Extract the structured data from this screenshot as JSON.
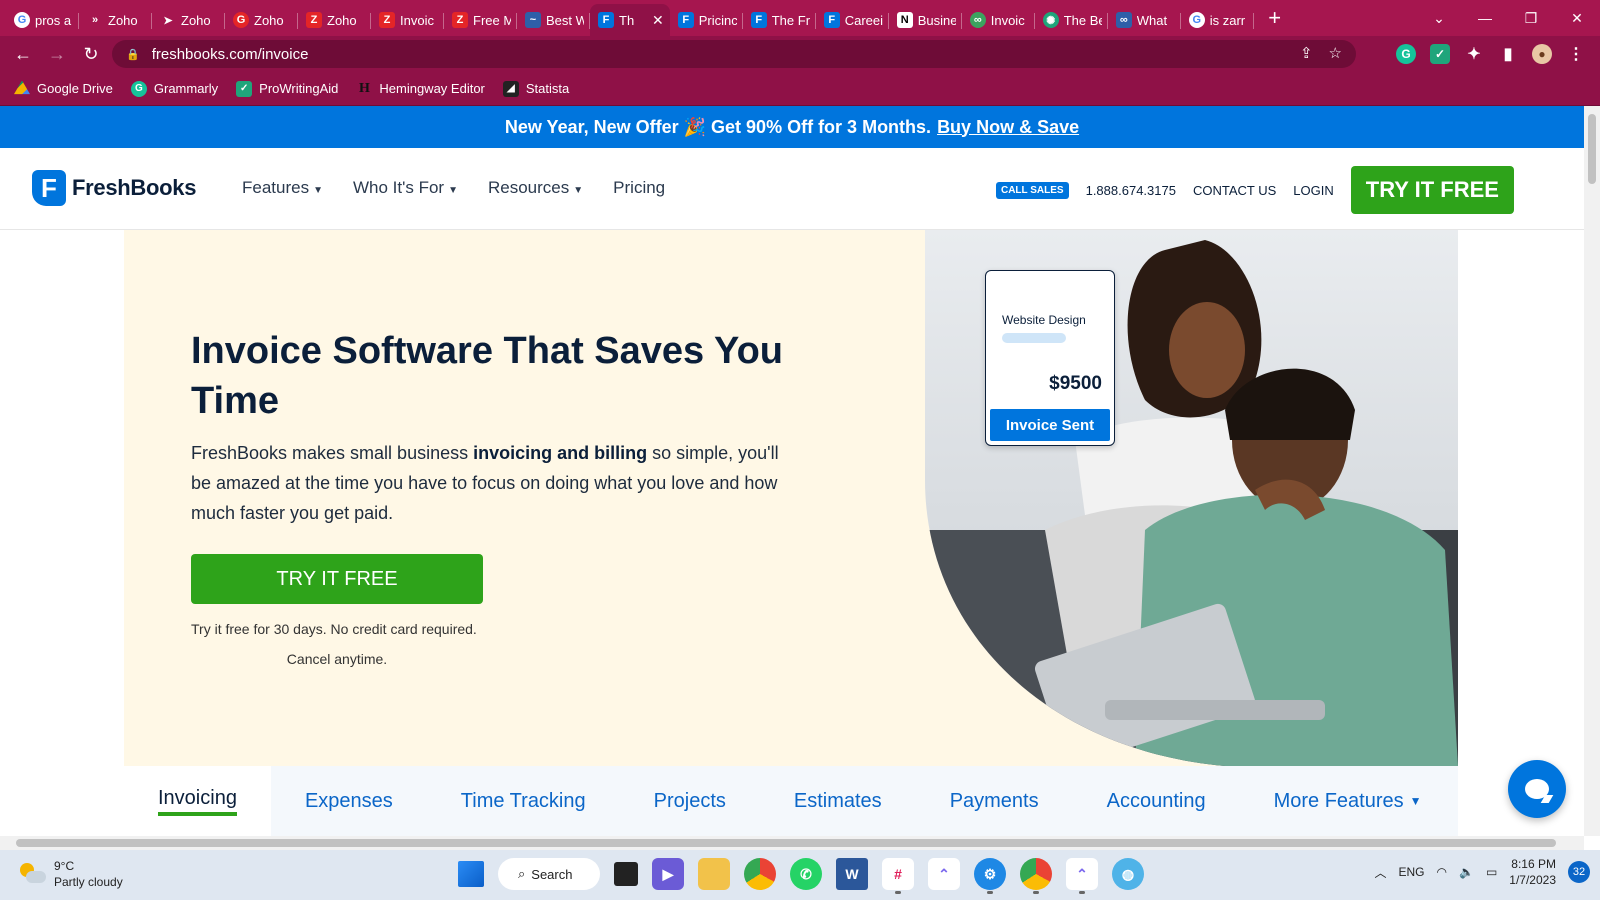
{
  "browser": {
    "tabs": [
      {
        "title": "pros a",
        "icon": "google-icon"
      },
      {
        "title": "Zoho",
        "icon": "zoho-icon"
      },
      {
        "title": "Zoho",
        "icon": "send-icon"
      },
      {
        "title": "Zoho",
        "icon": "grammarly-icon"
      },
      {
        "title": "Zoho",
        "icon": "zoho-z-icon"
      },
      {
        "title": "Invoic",
        "icon": "zoho-z-icon"
      },
      {
        "title": "Free M",
        "icon": "zoho-z-icon"
      },
      {
        "title": "Best W",
        "icon": "blog-icon"
      },
      {
        "title": "Th",
        "icon": "freshbooks-icon",
        "active": true
      },
      {
        "title": "Pricinc",
        "icon": "freshbooks-icon"
      },
      {
        "title": "The Fr",
        "icon": "freshbooks-icon"
      },
      {
        "title": "Careei",
        "icon": "freshbooks-icon"
      },
      {
        "title": "Busine",
        "icon": "notion-icon"
      },
      {
        "title": "Invoic",
        "icon": "invoice-icon"
      },
      {
        "title": "The Be",
        "icon": "openai-icon"
      },
      {
        "title": "What",
        "icon": "link-icon"
      },
      {
        "title": "is zarr",
        "icon": "google-icon"
      }
    ],
    "url": "freshbooks.com/invoice",
    "bookmarks": [
      {
        "label": "Google Drive"
      },
      {
        "label": "Grammarly"
      },
      {
        "label": "ProWritingAid"
      },
      {
        "label": "Hemingway Editor"
      },
      {
        "label": "Statista"
      }
    ]
  },
  "promo": {
    "text": "New Year, New Offer 🎉 Get 90% Off for 3 Months.",
    "link": "Buy Now & Save"
  },
  "nav": {
    "logo": "FreshBooks",
    "menu": [
      "Features",
      "Who It's For",
      "Resources",
      "Pricing"
    ],
    "call_sales": "CALL SALES",
    "phone": "1.888.674.3175",
    "contact": "CONTACT US",
    "login": "LOGIN",
    "cta": "TRY IT FREE"
  },
  "hero": {
    "title": "Invoice Software That Saves You Time",
    "body_pre": "FreshBooks makes small business ",
    "body_bold": "invoicing and billing",
    "body_post": " so simple, you'll be amazed at the time you have to focus on doing what you love and how much faster you get paid.",
    "cta": "TRY IT FREE",
    "note1": "Try it free for 30 days. No credit card required.",
    "note2": "Cancel anytime."
  },
  "invoice_card": {
    "title": "Website Design",
    "amount": "$9500",
    "button": "Invoice Sent"
  },
  "feature_tabs": [
    "Invoicing",
    "Expenses",
    "Time Tracking",
    "Projects",
    "Estimates",
    "Payments",
    "Accounting",
    "More Features"
  ],
  "taskbar": {
    "temp": "9°C",
    "weather": "Partly cloudy",
    "search": "Search",
    "lang": "ENG",
    "time": "8:16 PM",
    "date": "1/7/2023",
    "notifications": "32"
  },
  "colors": {
    "brand_blue": "#0075dd",
    "cta_green": "#2ea31a",
    "browser_theme": "#a6164f",
    "hero_bg": "#fff8e6"
  }
}
